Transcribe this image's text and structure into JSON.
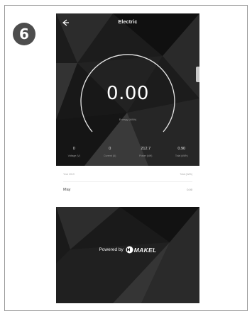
{
  "step": {
    "number": "6"
  },
  "app": {
    "title": "Electric",
    "reading": "0.00",
    "reading_caption": "Energy (kWh)",
    "stats": [
      {
        "value": "0",
        "label": "Voltage (V)"
      },
      {
        "value": "0",
        "label": "Current (A)"
      },
      {
        "value": "212.7",
        "label": "Power (kW)"
      },
      {
        "value": "0.90",
        "label": "Total (kWh)"
      }
    ],
    "history": {
      "header_left": "Year 2019",
      "header_right": "Total (kWh)",
      "rows": [
        {
          "month": "May",
          "value": "0.00"
        }
      ]
    },
    "footer": {
      "powered_by": "Powered by",
      "brand": "MAKEL"
    }
  },
  "colors": {
    "badge": "#4d4d4d",
    "background": "#1a1a1a",
    "panel": "#ffffff",
    "accent": "#ffffff"
  }
}
